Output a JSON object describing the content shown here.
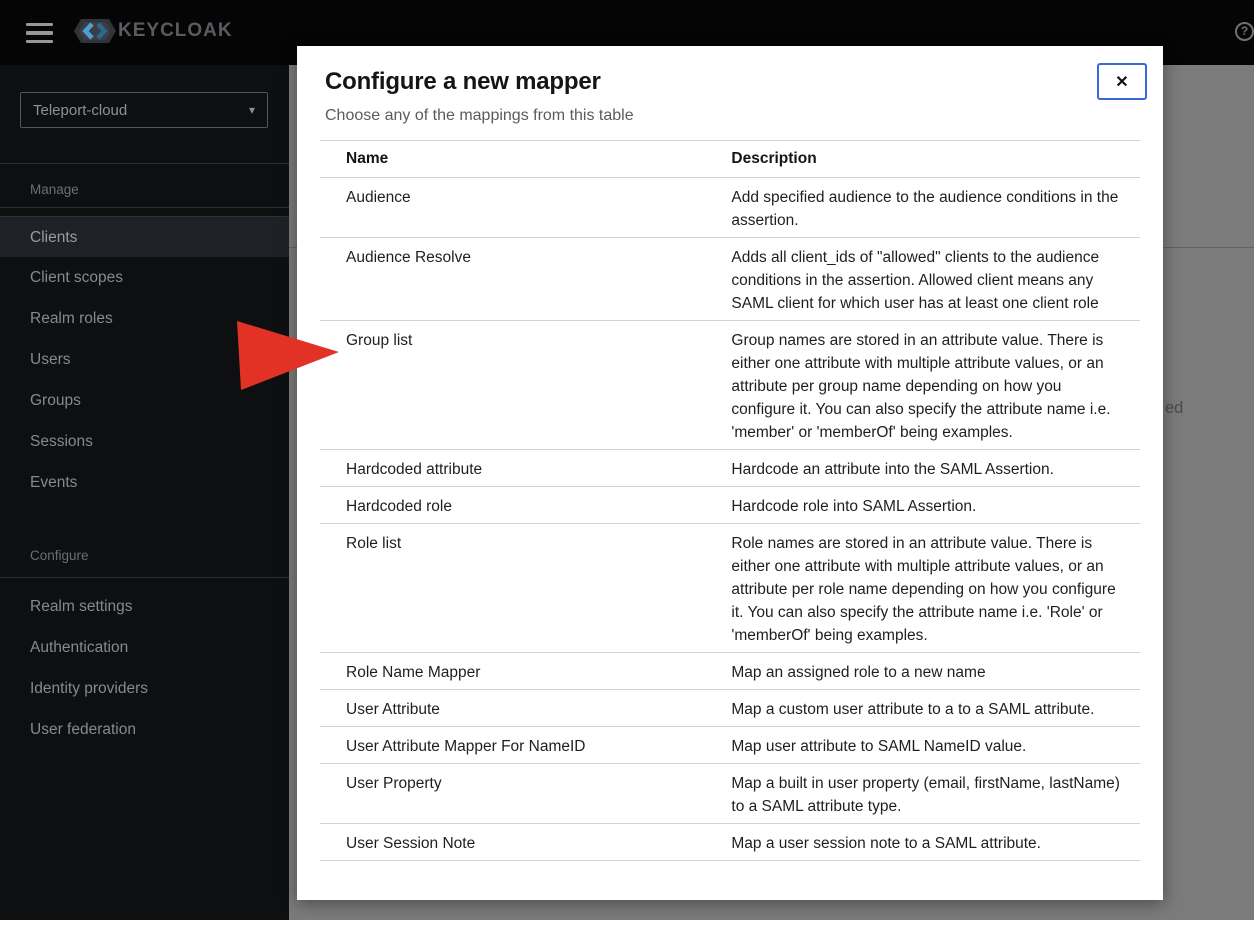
{
  "header": {
    "logo_text": "KEYCLOAK",
    "help_glyph": "?"
  },
  "sidebar": {
    "realm_selector": {
      "value": "Teleport-cloud",
      "caret": "▾"
    },
    "sections": [
      {
        "label": "Manage",
        "selected": "Clients",
        "items": [
          "Clients",
          "Client scopes",
          "Realm roles",
          "Users",
          "Groups",
          "Sessions",
          "Events"
        ]
      },
      {
        "label": "Configure",
        "selected": null,
        "items": [
          "Realm settings",
          "Authentication",
          "Identity providers",
          "User federation"
        ]
      }
    ]
  },
  "modal": {
    "title": "Configure a new mapper",
    "subtitle": "Choose any of the mappings from this table",
    "close_glyph": "✕",
    "table": {
      "columns": [
        "Name",
        "Description"
      ],
      "rows": [
        {
          "name": "Audience",
          "description": "Add specified audience to the audience conditions in the assertion."
        },
        {
          "name": "Audience Resolve",
          "description": "Adds all client_ids of \"allowed\" clients to the audience conditions in the assertion. Allowed client means any SAML client for which user has at least one client role"
        },
        {
          "name": "Group list",
          "description": "Group names are stored in an attribute value. There is either one attribute with multiple attribute values, or an attribute per group name depending on how you configure it. You can also specify the attribute name i.e. 'member' or 'memberOf' being examples."
        },
        {
          "name": "Hardcoded attribute",
          "description": "Hardcode an attribute into the SAML Assertion."
        },
        {
          "name": "Hardcoded role",
          "description": "Hardcode role into SAML Assertion."
        },
        {
          "name": "Role list",
          "description": "Role names are stored in an attribute value. There is either one attribute with multiple attribute values, or an attribute per role name depending on how you configure it. You can also specify the attribute name i.e. 'Role' or 'memberOf' being examples."
        },
        {
          "name": "Role Name Mapper",
          "description": "Map an assigned role to a new name"
        },
        {
          "name": "User Attribute",
          "description": "Map a custom user attribute to a to a SAML attribute."
        },
        {
          "name": "User Attribute Mapper For NameID",
          "description": "Map user attribute to SAML NameID value."
        },
        {
          "name": "User Property",
          "description": "Map a built in user property (email, firstName, lastName) to a SAML attribute type."
        },
        {
          "name": "User Session Note",
          "description": "Map a user session note to a SAML attribute."
        }
      ]
    }
  },
  "background": {
    "partial_text": "ed"
  },
  "annotation": {
    "shape": "arrow-right",
    "points_to": "Group list",
    "color": "#e23226"
  },
  "colors": {
    "masthead_bg": "#050505",
    "sidebar_bg": "#0d0f11",
    "sidebar_selected_bg": "#1e2125",
    "backdrop_gray": "#7b7b7b",
    "modal_bg": "#ffffff",
    "table_border": "#d2d2d2",
    "close_button_border": "#3b66d9",
    "arrow_red": "#e23226"
  }
}
